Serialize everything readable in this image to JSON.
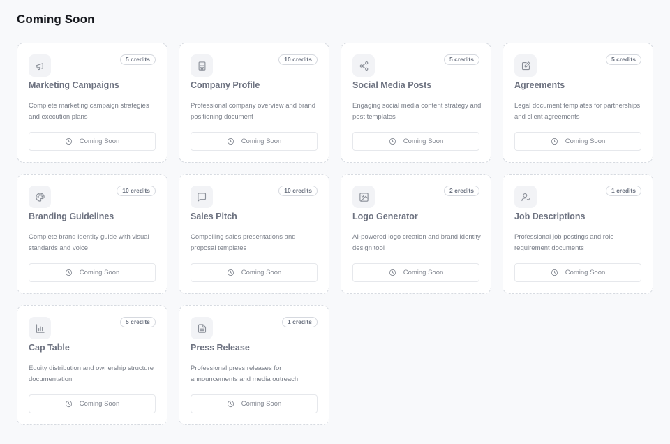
{
  "page": {
    "title": "Coming Soon"
  },
  "colors": {
    "background": "#f8f9fb",
    "card_border": "#d7dbe1",
    "icon_bg": "#f2f3f6",
    "muted_text": "#6d7280"
  },
  "cards": [
    {
      "title": "Marketing Campaigns",
      "credits": "5 credits",
      "icon": "megaphone-icon",
      "description": "Complete marketing campaign strategies and execution plans",
      "button_label": "Coming Soon"
    },
    {
      "title": "Company Profile",
      "credits": "10 credits",
      "icon": "building-icon",
      "description": "Professional company overview and brand positioning document",
      "button_label": "Coming Soon"
    },
    {
      "title": "Social Media Posts",
      "credits": "5 credits",
      "icon": "share-icon",
      "description": "Engaging social media content strategy and post templates",
      "button_label": "Coming Soon"
    },
    {
      "title": "Agreements",
      "credits": "5 credits",
      "icon": "edit-document-icon",
      "description": "Legal document templates for partnerships and client agreements",
      "button_label": "Coming Soon"
    },
    {
      "title": "Branding Guidelines",
      "credits": "10 credits",
      "icon": "palette-icon",
      "description": "Complete brand identity guide with visual standards and voice",
      "button_label": "Coming Soon"
    },
    {
      "title": "Sales Pitch",
      "credits": "10 credits",
      "icon": "message-square-icon",
      "description": "Compelling sales presentations and proposal templates",
      "button_label": "Coming Soon"
    },
    {
      "title": "Logo Generator",
      "credits": "2 credits",
      "icon": "image-icon",
      "description": "AI-powered logo creation and brand identity design tool",
      "button_label": "Coming Soon"
    },
    {
      "title": "Job Descriptions",
      "credits": "1 credits",
      "icon": "user-check-icon",
      "description": "Professional job postings and role requirement documents",
      "button_label": "Coming Soon"
    },
    {
      "title": "Cap Table",
      "credits": "5 credits",
      "icon": "bar-chart-icon",
      "description": "Equity distribution and ownership structure documentation",
      "button_label": "Coming Soon"
    },
    {
      "title": "Press Release",
      "credits": "1 credits",
      "icon": "file-text-icon",
      "description": "Professional press releases for announcements and media outreach",
      "button_label": "Coming Soon"
    }
  ]
}
